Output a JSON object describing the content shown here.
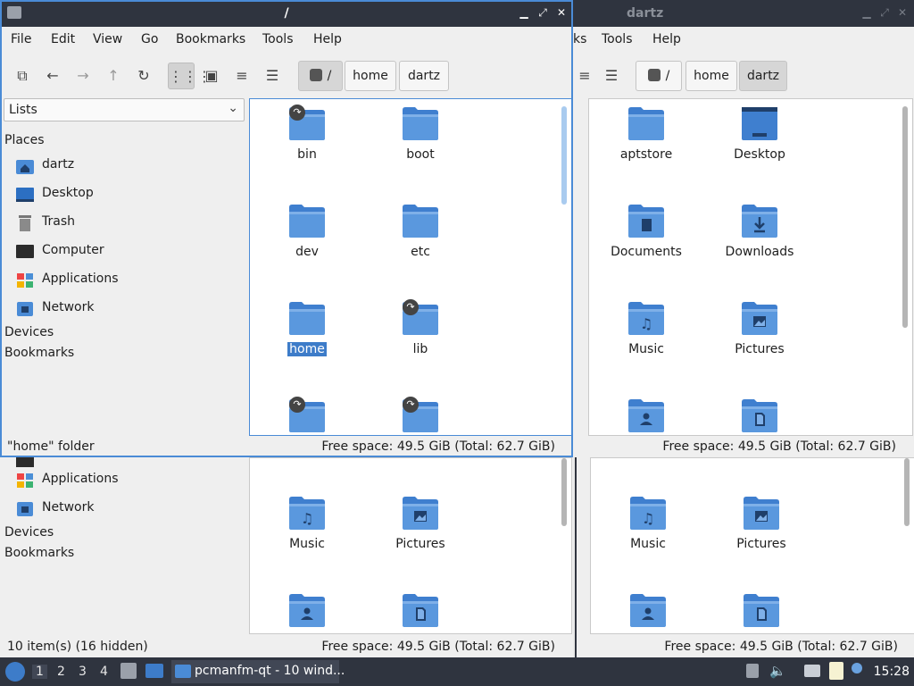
{
  "windows": {
    "front": {
      "title": "/",
      "menu": [
        "File",
        "Edit",
        "View",
        "Go",
        "Bookmarks",
        "Tools",
        "Help"
      ],
      "path": [
        "/",
        "home",
        "dartz"
      ],
      "side_combo": "Lists",
      "places_header": "Places",
      "places": [
        "dartz",
        "Desktop",
        "Trash",
        "Computer",
        "Applications",
        "Network"
      ],
      "devices": "Devices",
      "bookmarks": "Bookmarks",
      "items": [
        {
          "name": "bin",
          "link": true
        },
        {
          "name": "boot",
          "link": false
        },
        {
          "name": "dev",
          "link": false
        },
        {
          "name": "etc",
          "link": false
        },
        {
          "name": "home",
          "link": false,
          "selected": true
        },
        {
          "name": "lib",
          "link": true
        },
        {
          "name": "",
          "link": true
        },
        {
          "name": "",
          "link": true
        }
      ],
      "status_left": "\"home\" folder",
      "status_right": "Free space: 49.5 GiB (Total: 62.7 GiB)"
    },
    "right_top": {
      "title": "dartz",
      "menu_visible": [
        "ks",
        "Tools",
        "Help"
      ],
      "path": [
        "/",
        "home",
        "dartz"
      ],
      "items": [
        {
          "name": "aptstore",
          "kind": "plain"
        },
        {
          "name": "Desktop",
          "kind": "desktop"
        },
        {
          "name": "Documents",
          "kind": "doc"
        },
        {
          "name": "Downloads",
          "kind": "download"
        },
        {
          "name": "Music",
          "kind": "music"
        },
        {
          "name": "Pictures",
          "kind": "picture"
        },
        {
          "name": "",
          "kind": "user"
        },
        {
          "name": "",
          "kind": "file"
        }
      ],
      "status_right": "Free space: 49.5 GiB (Total: 62.7 GiB)"
    },
    "left_bottom": {
      "places_visible": [
        "Applications",
        "Network"
      ],
      "devices": "Devices",
      "bookmarks": "Bookmarks",
      "items": [
        {
          "name": "Music",
          "kind": "music"
        },
        {
          "name": "Pictures",
          "kind": "picture"
        },
        {
          "name": "",
          "kind": "user"
        },
        {
          "name": "",
          "kind": "file"
        }
      ],
      "status_left": "10 item(s) (16 hidden)",
      "status_right": "Free space: 49.5 GiB (Total: 62.7 GiB)"
    },
    "right_bottom": {
      "items": [
        {
          "name": "Music",
          "kind": "music"
        },
        {
          "name": "Pictures",
          "kind": "picture"
        },
        {
          "name": "",
          "kind": "user"
        },
        {
          "name": "",
          "kind": "file"
        }
      ],
      "status_right": "Free space: 49.5 GiB (Total: 62.7 GiB)"
    }
  },
  "taskbar": {
    "workspaces": [
      "1",
      "2",
      "3",
      "4"
    ],
    "task_label": "pcmanfm-qt - 10 wind...",
    "clock": "15:28"
  },
  "colors": {
    "folder": "#4a8bd6",
    "folder_tab": "#5e9de0",
    "accent": "#3d7cc9",
    "panel": "#2f343f"
  }
}
